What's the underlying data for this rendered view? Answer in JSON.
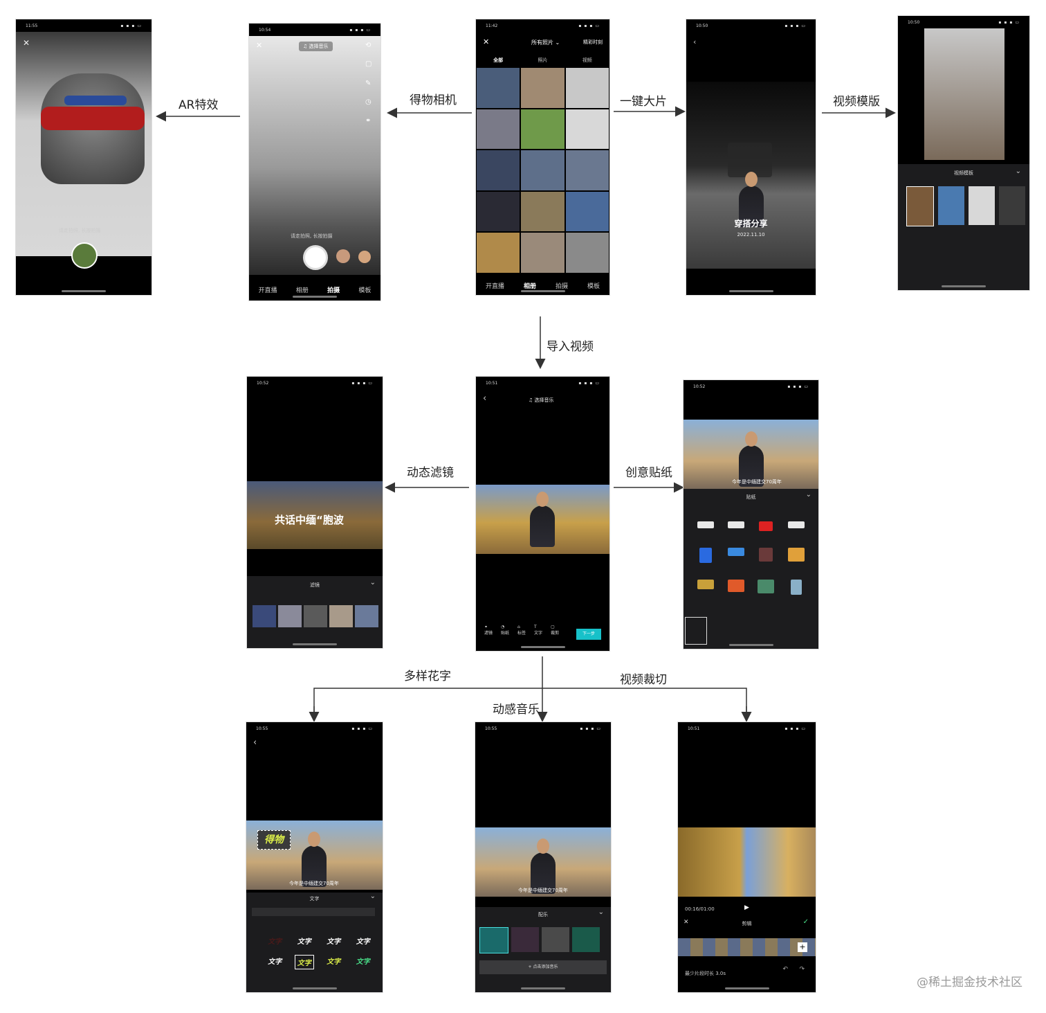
{
  "labels": {
    "ar": "AR特效",
    "camera": "得物相机",
    "one_click": "一键大片",
    "template": "视频模版",
    "import": "导入视频",
    "filter": "动态滤镜",
    "sticker": "创意贴纸",
    "text": "多样花字",
    "music": "动感音乐",
    "crop": "视频裁切"
  },
  "watermark": "@稀土掘金技术社区",
  "screens": {
    "ar": {
      "time": "11:55",
      "hint": "请走拍照, 长按拍摄"
    },
    "camera": {
      "time": "10:54",
      "music": "选择音乐",
      "hint": "请走拍照, 长按拍摄",
      "tabs": [
        "开直播",
        "相册",
        "拍摄",
        "模板"
      ]
    },
    "album": {
      "time": "11:42",
      "title": "所有照片",
      "right": "精彩时刻",
      "tabs": [
        "全部",
        "照片",
        "视频"
      ],
      "bottom": [
        "开直播",
        "相册",
        "拍摄",
        "模板"
      ]
    },
    "oneclick": {
      "time": "10:50",
      "headline": "穿搭分享",
      "date": "2022.11.10"
    },
    "template": {
      "time": "10:50",
      "panel": "视频模板"
    },
    "editor": {
      "time": "10:51",
      "music": "选择音乐",
      "next": "下一步",
      "tools": [
        "滤镜",
        "贴纸",
        "标签",
        "文字",
        "裁剪"
      ]
    },
    "filter": {
      "time": "10:52",
      "overlay": "共话中缅“胞波",
      "panel": "滤镜"
    },
    "sticker": {
      "time": "10:52",
      "panel": "贴纸",
      "subtitle": "今年是中缅建交70周年"
    },
    "text": {
      "time": "10:55",
      "panel": "文字",
      "sample": "文字",
      "logo": "得物",
      "subtitle": "今年是中缅建交70周年"
    },
    "music": {
      "time": "10:55",
      "panel": "配乐",
      "subtitle": "今年是中缅建交70周年",
      "button": "+ 点击添加音乐"
    },
    "crop": {
      "time": "10:51",
      "panel": "剪辑",
      "timecode": "00:16/01:00",
      "hint": "最少片段时长 3.0s"
    }
  },
  "colors": {
    "teal": "#17c1c9",
    "dark": "#111111",
    "arrow": "#333333"
  }
}
